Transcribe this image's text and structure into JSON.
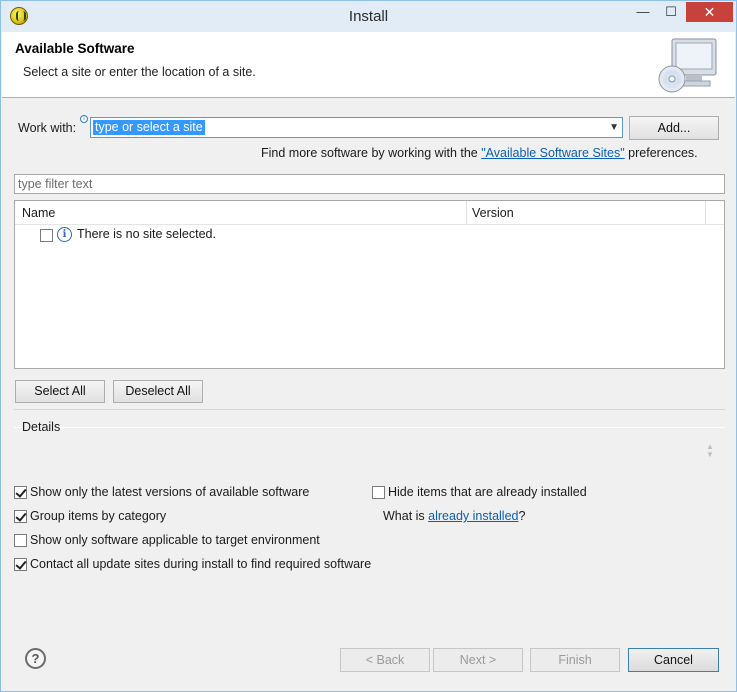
{
  "window": {
    "title": "Install",
    "controls": {
      "minimize": "—",
      "maximize": "☐",
      "close": "✕"
    }
  },
  "banner": {
    "title": "Available Software",
    "description": "Select a site or enter the location of a site.",
    "icon": "computer-cd-icon"
  },
  "work_with": {
    "label": "Work with:",
    "value": "type or select a site",
    "add_label": "Add..."
  },
  "find_more": {
    "prefix": "Find more software by working with the ",
    "link": "\"Available Software Sites\"",
    "suffix": " preferences."
  },
  "filter": {
    "placeholder": "type filter text"
  },
  "tree": {
    "columns": [
      "Name",
      "Version"
    ],
    "rows": [
      {
        "checked": false,
        "icon": "info-icon",
        "text": "There is no site selected."
      }
    ]
  },
  "selection_buttons": {
    "select_all": "Select All",
    "deselect_all": "Deselect All"
  },
  "details": {
    "label": "Details"
  },
  "options": {
    "latest_versions": {
      "label": "Show only the latest versions of available software",
      "checked": true
    },
    "group_by_category": {
      "label": "Group items by category",
      "checked": true
    },
    "target_env": {
      "label": "Show only software applicable to target environment",
      "checked": false
    },
    "contact_sites": {
      "label": "Contact all update sites during install to find required software",
      "checked": true
    },
    "hide_installed": {
      "label": "Hide items that are already installed",
      "checked": false
    },
    "what_is": {
      "prefix": "What is ",
      "link": "already installed",
      "suffix": "?"
    }
  },
  "footer": {
    "help": "?",
    "back": "< Back",
    "next": "Next >",
    "finish": "Finish",
    "cancel": "Cancel"
  },
  "colors": {
    "accent": "#3399ff",
    "link": "#0b5fb3",
    "close": "#c7423b"
  }
}
